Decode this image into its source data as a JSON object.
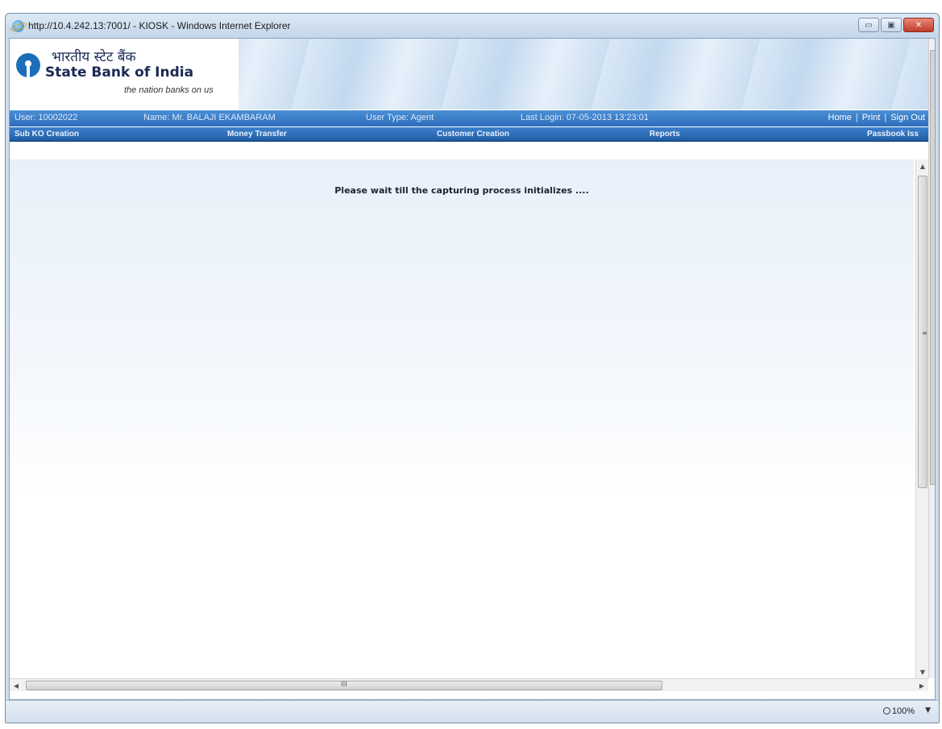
{
  "window": {
    "title": "http://10.4.242.13:7001/ - KIOSK - Windows Internet Explorer",
    "min_glyph": "▭",
    "max_glyph": "▣",
    "close_glyph": "✕"
  },
  "banner": {
    "hindi_name": "भारतीय स्टेट बैंक",
    "bank_name": "State Bank of India",
    "tagline": "the nation banks on us"
  },
  "user_info": {
    "user": "User: 10002022",
    "name": "Name: Mr.  BALAJI EKAMBARAM",
    "user_type": "User Type: Agent",
    "last_login": "Last Login: 07-05-2013 13:23:01",
    "links": {
      "home": "Home",
      "print": "Print",
      "sign_out": "Sign Out",
      "separator": "|"
    }
  },
  "nav": {
    "items": [
      "Sub KO Creation",
      "Money Transfer",
      "Customer Creation",
      "Reports",
      "Passbook Iss"
    ]
  },
  "main": {
    "message": "Please wait till the capturing process initializes ...."
  },
  "scrollbars": {
    "up": "▲",
    "down": "▼",
    "left": "◀",
    "right": "▶",
    "v_grip": "≡",
    "h_grip": "III"
  },
  "status": {
    "zoom": "100%",
    "zoom_arrow": "▼"
  },
  "colors": {
    "info_bar": "#2d6eba",
    "nav_bar": "#235fa8",
    "brand_blue": "#1b6fb8"
  }
}
